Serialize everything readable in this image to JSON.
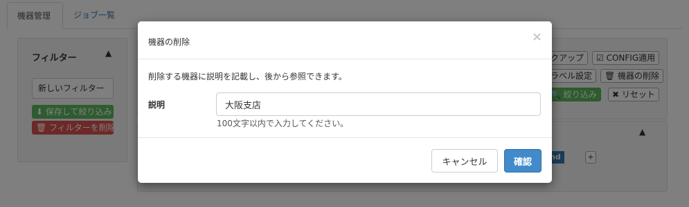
{
  "tabs": [
    {
      "label": "機器管理"
    },
    {
      "label": "ジョブ一覧"
    }
  ],
  "filter": {
    "title": "フィルター",
    "select_value": "新しいフィルター",
    "save_label": "⬇ 保存して絞り込み",
    "delete_label": "🗑 フィルターを削除"
  },
  "toolbar": {
    "backup_label": "クアップ",
    "config_label": "☑ CONFIG適用",
    "label_setting": "ラベル設定",
    "delete_device": "🗑 機器の削除",
    "search_label": "🔍 絞り込み",
    "reset_label": "✖ リセット",
    "chip_label": "nd",
    "plus_label": "+"
  },
  "modal": {
    "title": "機器の削除",
    "close": "×",
    "description": "削除する機器に説明を記載し、後から参照できます。",
    "field_label": "説明",
    "field_value": "大阪支店",
    "field_help": "100文字以内で入力してください。",
    "cancel_label": "キャンセル",
    "ok_label": "確認"
  }
}
